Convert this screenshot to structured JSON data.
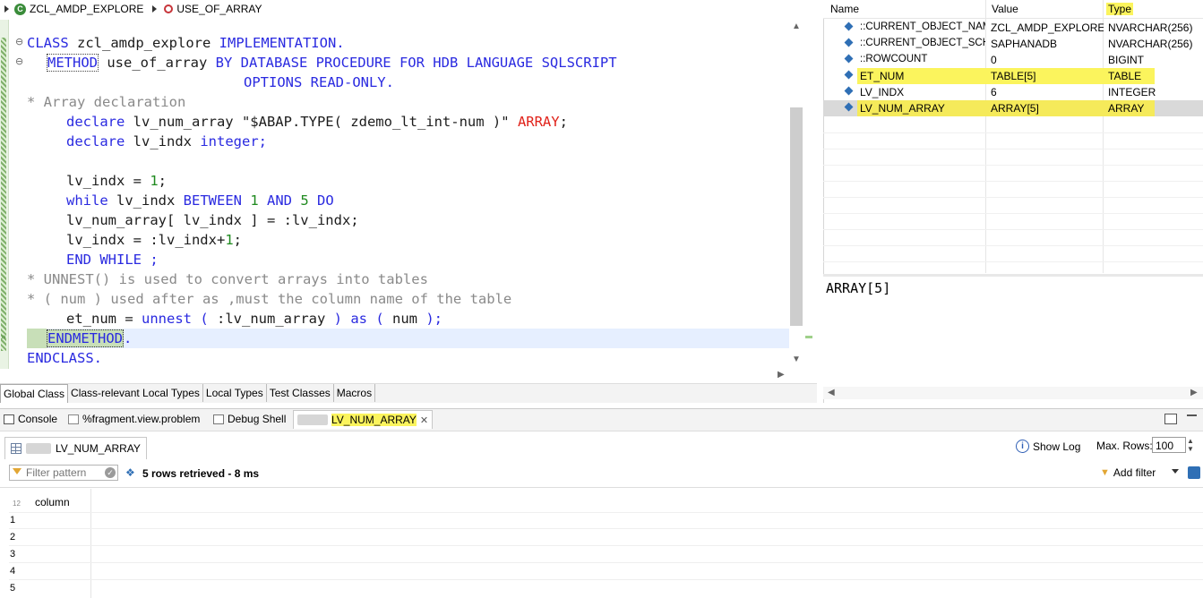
{
  "breadcrumb": {
    "class_name": "ZCL_AMDP_EXPLORE",
    "method_name": "USE_OF_ARRAY"
  },
  "code": {
    "line1": {
      "a": "CLASS",
      "b": " zcl_amdp_explore ",
      "c": "IMPLEMENTATION."
    },
    "line2": {
      "a": "METHOD",
      "b": " use_of_array ",
      "c": "BY DATABASE PROCEDURE FOR HDB LANGUAGE SQLSCRIPT"
    },
    "line3": {
      "a": "OPTIONS READ-ONLY."
    },
    "line4": {
      "a": "* Array declaration"
    },
    "line5": {
      "a": "declare",
      "b": " lv_num_array \"$ABAP.TYPE( zdemo_lt_int-num )\" ",
      "c": "ARRAY",
      "d": ";"
    },
    "line6": {
      "a": "declare",
      "b": " lv_indx ",
      "c": "integer;"
    },
    "line8": {
      "a": "lv_indx = ",
      "b": "1",
      "c": ";"
    },
    "line9": {
      "a": "while",
      "b": " lv_indx ",
      "c": "BETWEEN ",
      "d": "1",
      "e": " AND ",
      "f": "5",
      "g": " DO"
    },
    "line10": {
      "a": "lv_num_array[ lv_indx ] = :lv_indx;"
    },
    "line11": {
      "a": "lv_indx = :lv_indx+",
      "b": "1",
      "c": ";"
    },
    "line12": {
      "a": "END WHILE ;"
    },
    "line13": {
      "a": "* UNNEST() is used to convert arrays into tables"
    },
    "line14": {
      "a": "* ( num ) used after as ,must the column name of the table"
    },
    "line15": {
      "a": "et_num = ",
      "b": "unnest ( ",
      "c": ":lv_num_array",
      "d": " ) as ( ",
      "e": "num",
      "f": " );"
    },
    "line16": {
      "a": "ENDMETHOD",
      "b": "."
    },
    "line17": {
      "a": "ENDCLASS."
    }
  },
  "editor_tabs": [
    "Global Class",
    "Class-relevant Local Types",
    "Local Types",
    "Test Classes",
    "Macros"
  ],
  "variables": {
    "headers": {
      "name": "Name",
      "value": "Value",
      "type": "Type"
    },
    "rows": [
      {
        "name": "::CURRENT_OBJECT_NAME",
        "value": "ZCL_AMDP_EXPLORE...",
        "type": "NVARCHAR(256)"
      },
      {
        "name": "::CURRENT_OBJECT_SCHEMA",
        "value": "SAPHANADB",
        "type": "NVARCHAR(256)"
      },
      {
        "name": "::ROWCOUNT",
        "value": "0",
        "type": "BIGINT"
      },
      {
        "name": "ET_NUM",
        "value": "TABLE[5]",
        "type": "TABLE"
      },
      {
        "name": "LV_INDX",
        "value": "6",
        "type": "INTEGER"
      },
      {
        "name": "LV_NUM_ARRAY",
        "value": "ARRAY[5]",
        "type": "ARRAY"
      }
    ],
    "detail": "ARRAY[5]"
  },
  "bottom_tabs": {
    "console": "Console",
    "fragment": "%fragment.view.problem",
    "debug_shell": "Debug Shell",
    "active": "LV_NUM_ARRAY",
    "close": "✕"
  },
  "result_view": {
    "subtab_label": "LV_NUM_ARRAY",
    "show_log": "Show Log",
    "max_rows_label": "Max. Rows:",
    "max_rows_value": "100",
    "filter_placeholder": "Filter pattern",
    "status": "5 rows retrieved - 8 ms",
    "add_filter": "Add filter",
    "column_type_hint": "12",
    "column_header": "column",
    "row_numbers": [
      "1",
      "2",
      "3",
      "4",
      "5"
    ]
  },
  "colors": {
    "keyword": "#2a2ae0",
    "comment": "#8a8a8a",
    "number": "#1f8a1f",
    "highlight": "#fbf45d"
  }
}
